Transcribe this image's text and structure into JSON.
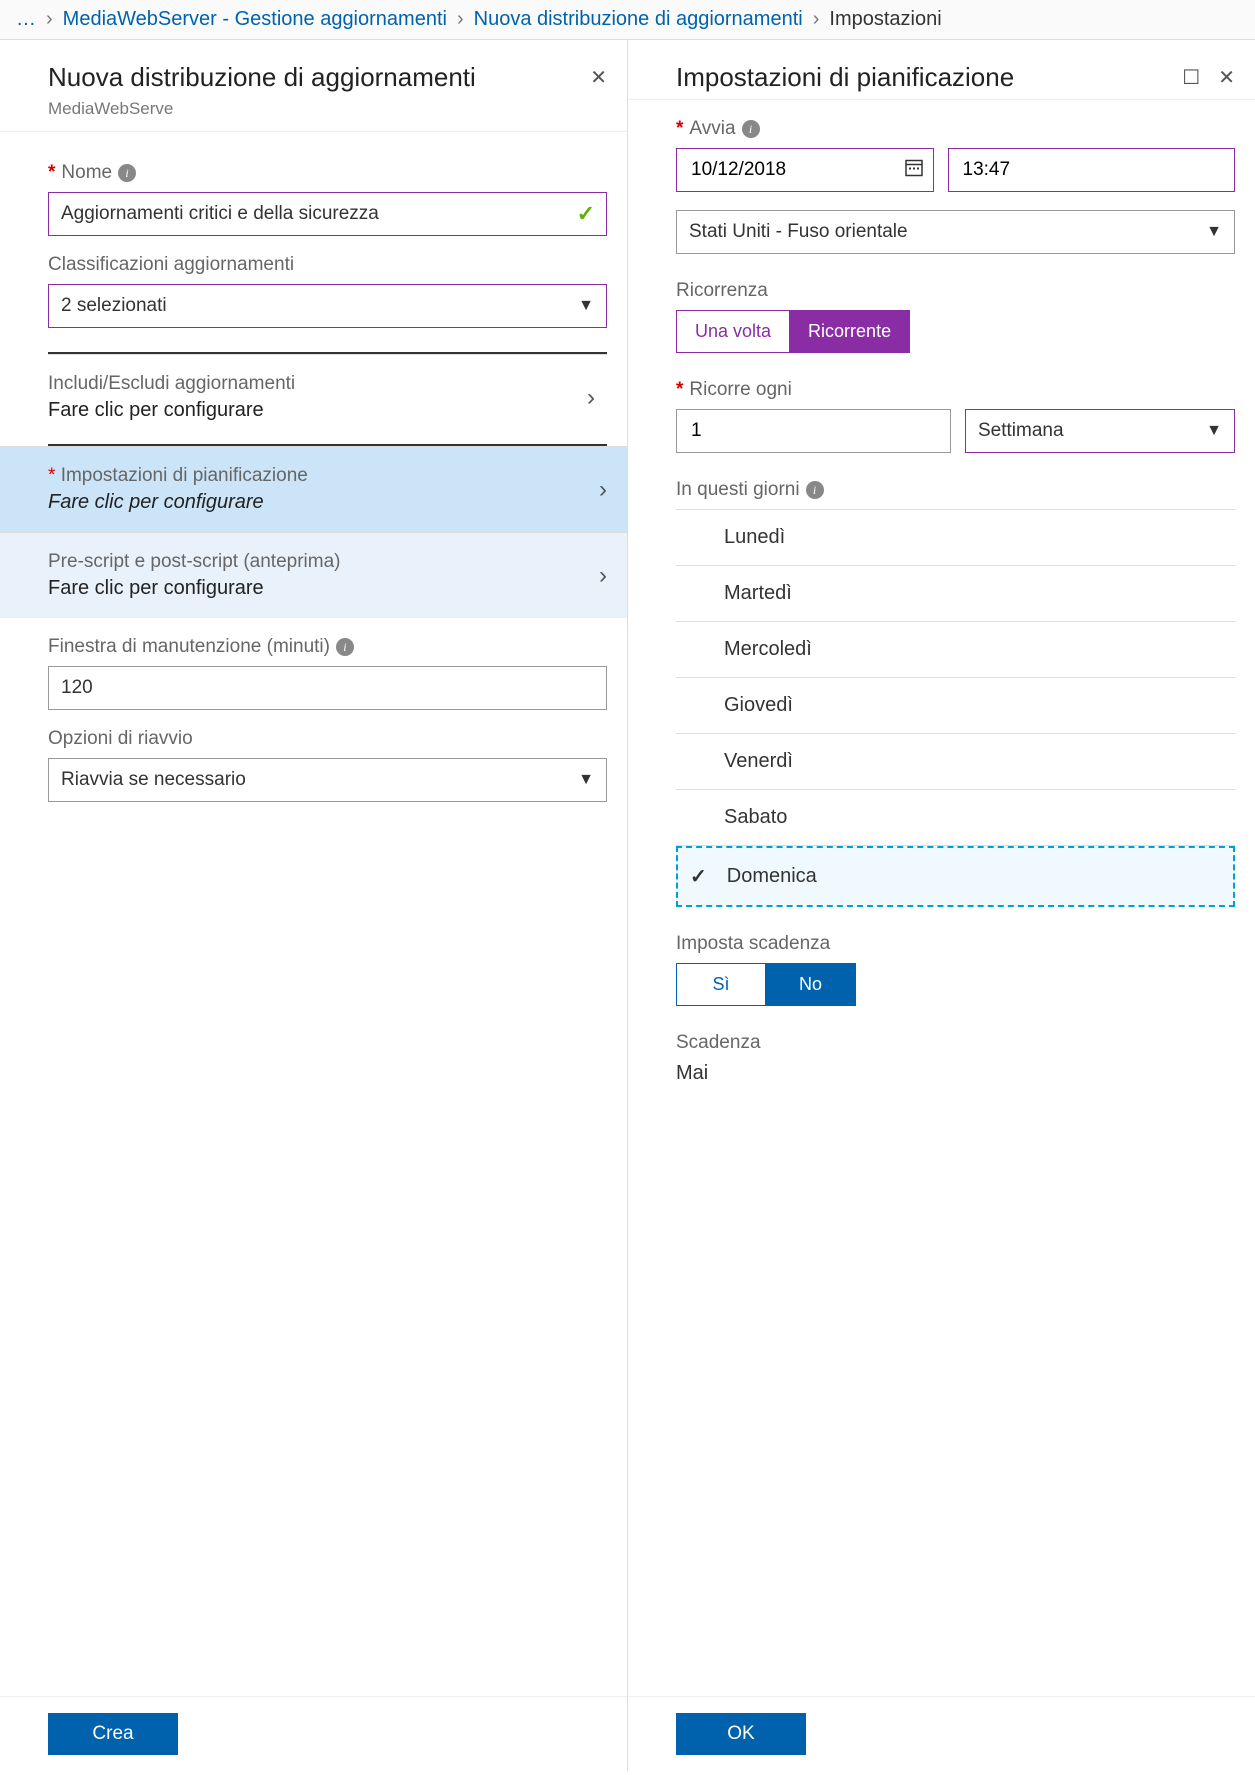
{
  "breadcrumb": {
    "ellipsis": "…",
    "item1": "MediaWebServer - Gestione aggiornamenti",
    "item2": "Nuova distribuzione di aggiornamenti",
    "current": "Impostazioni"
  },
  "leftPanel": {
    "title": "Nuova distribuzione di aggiornamenti",
    "subtitle": "MediaWebServe",
    "nameLabel": "Nome",
    "nameValue": "Aggiornamenti critici e della sicurezza",
    "classLabel": "Classificazioni aggiornamenti",
    "classValue": "2 selezionati",
    "includeTitle": "Includi/Escludi aggiornamenti",
    "includeAction": "Fare clic per configurare",
    "scheduleTitle": "Impostazioni di pianificazione",
    "scheduleAction": "Fare clic per configurare",
    "scriptTitle": "Pre-script e post-script (anteprima)",
    "scriptAction": "Fare clic per configurare",
    "maintLabel": "Finestra di manutenzione (minuti)",
    "maintValue": "120",
    "rebootLabel": "Opzioni di riavvio",
    "rebootValue": "Riavvia se necessario",
    "createBtn": "Crea"
  },
  "rightPanel": {
    "title": "Impostazioni di pianificazione",
    "startLabel": "Avvia",
    "dateValue": "10/12/2018",
    "timeValue": "13:47",
    "tzValue": "Stati Uniti - Fuso orientale",
    "recurrenceLabel": "Ricorrenza",
    "onceLabel": "Una volta",
    "recurringLabel": "Ricorrente",
    "recurEveryLabel": "Ricorre ogni",
    "recurNum": "1",
    "recurUnit": "Settimana",
    "daysLabel": "In questi giorni",
    "days": {
      "mon": "Lunedì",
      "tue": "Martedì",
      "wed": "Mercoledì",
      "thu": "Giovedì",
      "fri": "Venerdì",
      "sat": "Sabato",
      "sun": "Domenica"
    },
    "setExpiryLabel": "Imposta scadenza",
    "yesLabel": "Sì",
    "noLabel": "No",
    "expiryLabel": "Scadenza",
    "expiryValue": "Mai",
    "okBtn": "OK"
  }
}
